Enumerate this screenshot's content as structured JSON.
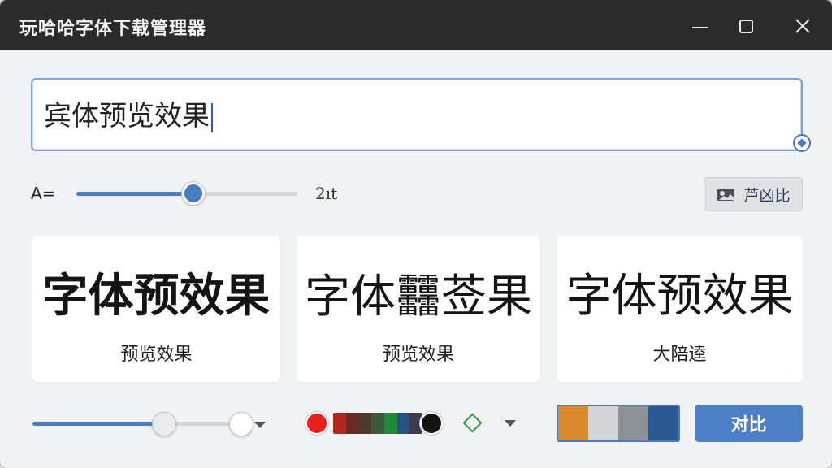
{
  "window": {
    "title": "玩哈哈字体下载管理器"
  },
  "preview_input": {
    "value": "宾体预览效果"
  },
  "size": {
    "label": "A=",
    "value_text": "2ıt",
    "slider_level": 0.53
  },
  "top_compare": {
    "label": "芦凶比",
    "icon": "image-compare-icon"
  },
  "cards": [
    {
      "sample": "字体预效果",
      "caption": "预览效果"
    },
    {
      "sample": "字体䨻莶果",
      "caption": "预览效果"
    },
    {
      "sample": "字体预效果",
      "caption": "大陪逵"
    }
  ],
  "bottom": {
    "weight_slider": {
      "level1": 0.6,
      "level2": 0.95
    },
    "color_red": "#e8201c",
    "color_black": "#141414",
    "strip_colors": [
      "#b3261e",
      "#6b2a22",
      "#4a3b2e",
      "#3d5a3e",
      "#1f8a3c",
      "#2a4f86",
      "#3c3c4a"
    ],
    "palette_colors": [
      "#d98a2f",
      "#d2d4d7",
      "#8e9095",
      "#2b5a92"
    ],
    "compare_label": "对比"
  },
  "accent_color": "#4d7fc6"
}
